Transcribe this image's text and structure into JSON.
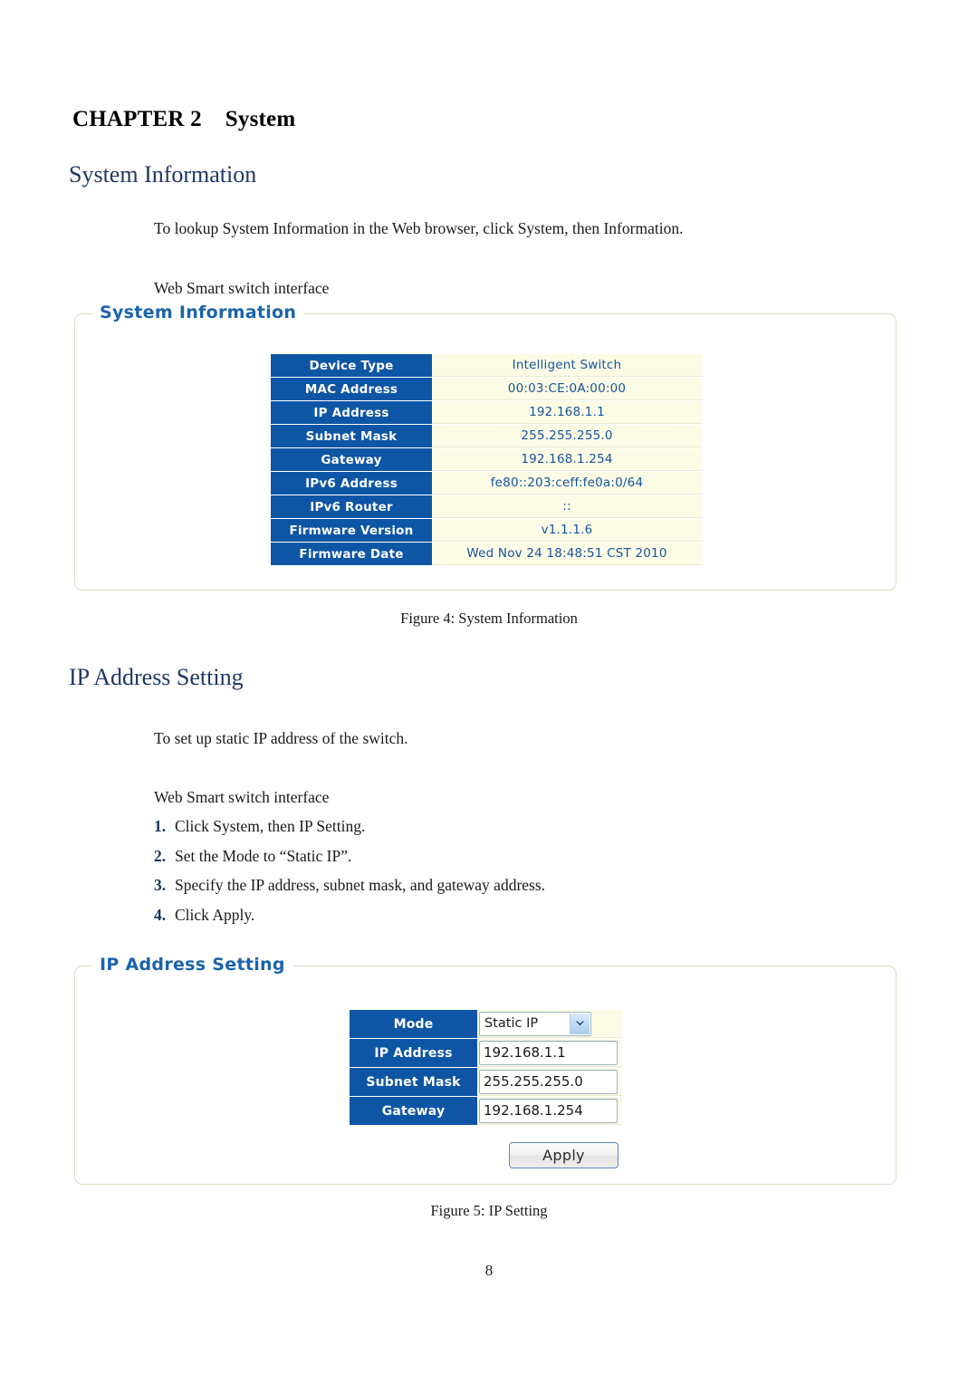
{
  "document": {
    "chapter_label": "CHAPTER 2",
    "chapter_title": "System",
    "page_number": "8"
  },
  "sections": {
    "system_information": {
      "heading": "System Information",
      "intro": "To lookup System Information in the Web browser, click System, then Information.",
      "interface_note": "Web Smart switch interface",
      "caption": "Figure 4: System Information"
    },
    "ip_address_setting": {
      "heading": "IP Address Setting",
      "intro": "To set up static IP address of the switch.",
      "interface_note": "Web Smart switch interface",
      "caption": "Figure 5: IP Setting",
      "steps": [
        {
          "num": "1.",
          "text": "Click System, then IP Setting."
        },
        {
          "num": "2.",
          "text": "Set the Mode to “Static IP”."
        },
        {
          "num": "3.",
          "text": "Specify the IP address, subnet mask, and gateway address."
        },
        {
          "num": "4.",
          "text": "Click Apply."
        }
      ]
    }
  },
  "system_information_panel": {
    "legend": "System Information",
    "rows": [
      {
        "label": "Device Type",
        "value": "Intelligent Switch"
      },
      {
        "label": "MAC Address",
        "value": "00:03:CE:0A:00:00"
      },
      {
        "label": "IP Address",
        "value": "192.168.1.1"
      },
      {
        "label": "Subnet Mask",
        "value": "255.255.255.0"
      },
      {
        "label": "Gateway",
        "value": "192.168.1.254"
      },
      {
        "label": "IPv6 Address",
        "value": "fe80::203:ceff:fe0a:0/64"
      },
      {
        "label": "IPv6 Router",
        "value": "::"
      },
      {
        "label": "Firmware Version",
        "value": "v1.1.1.6"
      },
      {
        "label": "Firmware Date",
        "value": "Wed Nov 24 18:48:51 CST 2010"
      }
    ]
  },
  "ip_address_setting_panel": {
    "legend": "IP Address Setting",
    "mode_label": "Mode",
    "mode_value": "Static IP",
    "fields": [
      {
        "label": "IP Address",
        "value": "192.168.1.1"
      },
      {
        "label": "Subnet Mask",
        "value": "255.255.255.0"
      },
      {
        "label": "Gateway",
        "value": "192.168.1.254"
      }
    ],
    "apply_label": "Apply"
  },
  "colors": {
    "header_blue": "#0e56a5",
    "value_cream": "#fcfbe6",
    "value_text_blue": "#15549b",
    "legend_blue": "#1a63ad",
    "section_heading_navy": "#1F3864",
    "panel_border": "#ddd9c3"
  }
}
